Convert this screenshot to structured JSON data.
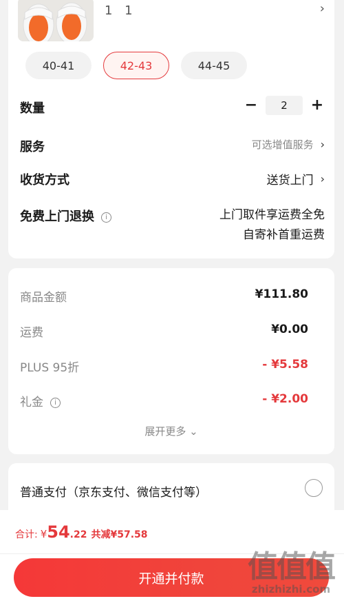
{
  "product": {
    "sku_text": "1 1"
  },
  "sizes": [
    {
      "label": "40-41",
      "selected": false
    },
    {
      "label": "42-43",
      "selected": true
    },
    {
      "label": "44-45",
      "selected": false
    }
  ],
  "quantity": {
    "label": "数量",
    "value": "2",
    "minus": "−",
    "plus": "+"
  },
  "service": {
    "label": "服务",
    "value": "可选增值服务"
  },
  "delivery": {
    "label": "收货方式",
    "value": "送货上门"
  },
  "return": {
    "label": "免费上门退换",
    "line1": "上门取件享运费全免",
    "line2": "自寄补首重运费"
  },
  "price_summary": {
    "rows": [
      {
        "label": "商品金额",
        "value": "¥111.80"
      },
      {
        "label": "运费",
        "value": "¥0.00"
      },
      {
        "label": "PLUS 95折",
        "value": "- ¥5.58"
      },
      {
        "label": "礼金",
        "value": "- ¥2.00"
      }
    ],
    "expand_label": "展开更多"
  },
  "payment": {
    "option_label": "普通支付（京东支付、微信支付等）"
  },
  "total": {
    "label": "合计:",
    "currency": "¥",
    "integer": "54",
    "decimal": ".22",
    "savings": "共减¥57.58"
  },
  "pay_button_label": "开通并付款",
  "watermark": {
    "glyphs": "值值值",
    "text": "zhizhizhi.com"
  },
  "colors": {
    "accent": "#e4393c",
    "background": "#f2f2f2"
  }
}
